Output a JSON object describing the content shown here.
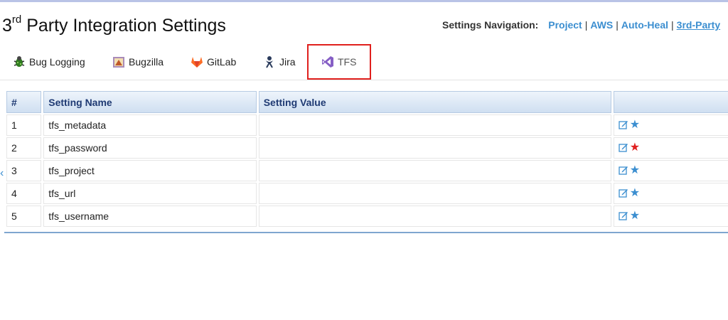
{
  "header": {
    "title_main_prefix": "3",
    "title_superscript": "rd",
    "title_rest": " Party Integration Settings"
  },
  "nav": {
    "label": "Settings Navigation:",
    "links": [
      "Project",
      "AWS",
      "Auto-Heal",
      "3rd-Party"
    ],
    "separator": "|"
  },
  "tabs": [
    {
      "label": "Bug Logging",
      "icon": "bug-icon"
    },
    {
      "label": "Bugzilla",
      "icon": "bugzilla-icon"
    },
    {
      "label": "GitLab",
      "icon": "gitlab-icon"
    },
    {
      "label": "Jira",
      "icon": "jira-icon"
    },
    {
      "label": "TFS",
      "icon": "visual-studio-icon",
      "selected": true
    }
  ],
  "table": {
    "headers": [
      "#",
      "Setting Name",
      "Setting Value",
      ""
    ],
    "rows": [
      {
        "num": "1",
        "name": "tfs_metadata",
        "value": "",
        "star_color": "#3b8ed0"
      },
      {
        "num": "2",
        "name": "tfs_password",
        "value": "",
        "star_color": "#e02020"
      },
      {
        "num": "3",
        "name": "tfs_project",
        "value": "",
        "star_color": "#3b8ed0"
      },
      {
        "num": "4",
        "name": "tfs_url",
        "value": "",
        "star_color": "#3b8ed0"
      },
      {
        "num": "5",
        "name": "tfs_username",
        "value": "",
        "star_color": "#3b8ed0"
      }
    ]
  },
  "colors": {
    "accent": "#3b8ed0",
    "highlight_border": "#e0201d",
    "header_text": "#1f3a73"
  }
}
